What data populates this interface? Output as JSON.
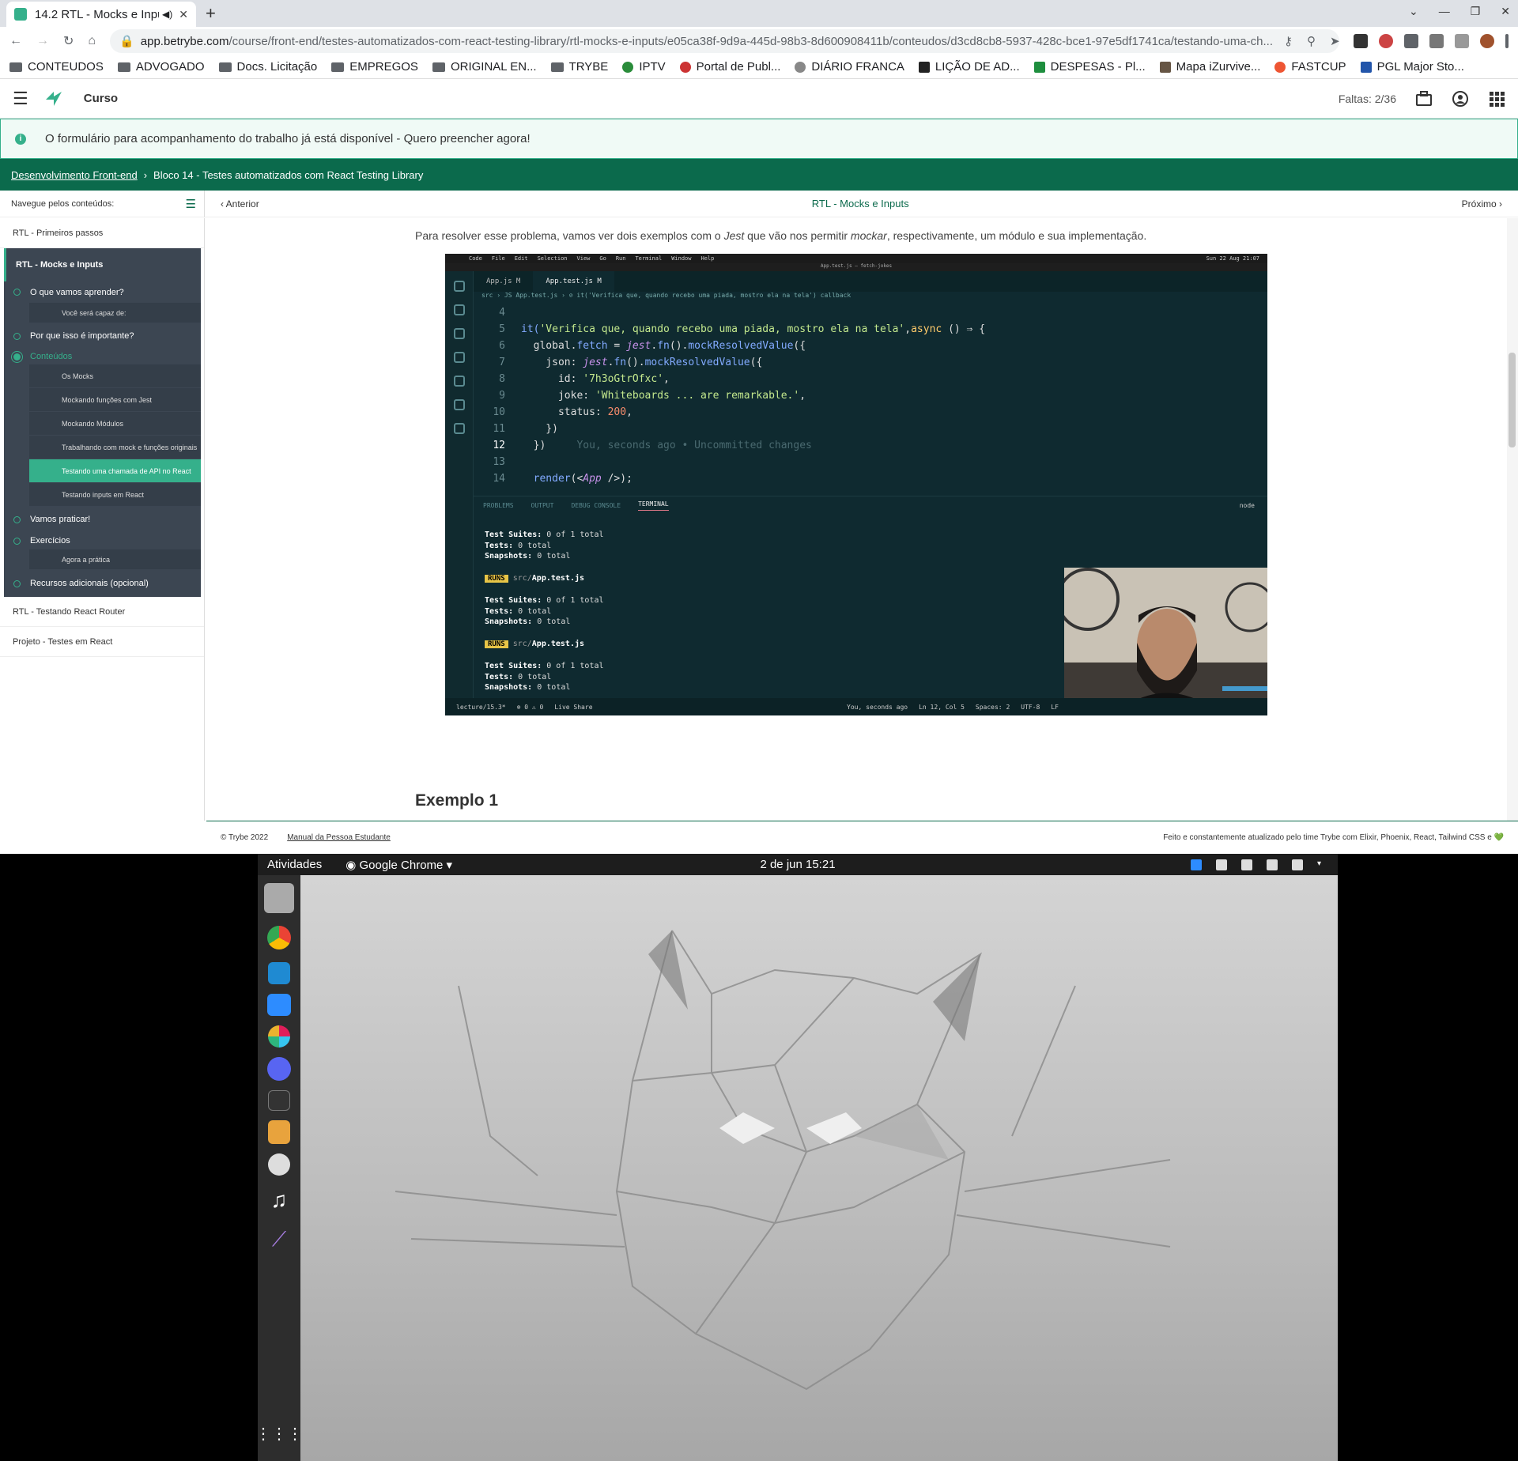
{
  "browser": {
    "tab_title": "14.2 RTL - Mocks e Inpu",
    "url_host": "app.betrybe.com",
    "url_path": "/course/front-end/testes-automatizados-com-react-testing-library/rtl-mocks-e-inputs/e05ca38f-9d9a-445d-98b3-8d600908411b/conteudos/d3cd8cb8-5937-428c-bce1-97e5df1741ca/testando-uma-ch...",
    "bookmarks": [
      "CONTEUDOS",
      "ADVOGADO",
      "Docs. Licitação",
      "EMPREGOS",
      "ORIGINAL EN...",
      "TRYBE",
      "IPTV",
      "Portal de Publ...",
      "DIÁRIO FRANCA",
      "LIÇÃO DE AD...",
      "DESPESAS - Pl...",
      "Mapa iZurvive...",
      "FASTCUP",
      "PGL Major Sto..."
    ]
  },
  "app": {
    "section": "Curso",
    "faltas": "Faltas: 2/36",
    "notice": "O formulário para acompanhamento do trabalho já está disponível - Quero preencher agora!",
    "breadcrumb": [
      "Desenvolvimento Front-end",
      "Bloco 14 - Testes automatizados com React Testing Library"
    ],
    "nav_label": "Navegue pelos conteúdos:",
    "prev": "Anterior",
    "next": "Próximo",
    "page_title": "RTL - Mocks e Inputs"
  },
  "sidebar": {
    "top_item": "RTL - Primeiros passos",
    "active_module": "RTL - Mocks e Inputs",
    "sections": [
      {
        "label": "O que vamos aprender?",
        "subs": [
          "Você será capaz de:"
        ]
      },
      {
        "label": "Por que isso é importante?",
        "subs": []
      },
      {
        "label": "Conteúdos",
        "subs": [
          "Os Mocks",
          "Mockando funções com Jest",
          "Mockando Módulos",
          "Trabalhando com mock e funções originais",
          "Testando uma chamada de API no React",
          "Testando inputs em React"
        ]
      },
      {
        "label": "Vamos praticar!",
        "subs": []
      },
      {
        "label": "Exercícios",
        "subs": [
          "Agora a prática"
        ]
      },
      {
        "label": "Recursos adicionais (opcional)",
        "subs": []
      }
    ],
    "bottom_items": [
      "RTL - Testando React Router",
      "Projeto - Testes em React"
    ]
  },
  "content": {
    "para_pre": "Para resolver esse problema, vamos ver dois exemplos com o ",
    "para_jest": "Jest",
    "para_mid": " que vão nos permitir ",
    "para_mockar": "mockar",
    "para_post": ", respectivamente, um módulo e sua implementação.",
    "heading": "Exemplo 1"
  },
  "video": {
    "mac_menu": [
      "Code",
      "File",
      "Edit",
      "Selection",
      "View",
      "Go",
      "Run",
      "Terminal",
      "Window",
      "Help"
    ],
    "mac_clock": "Sun 22 Aug 21:07",
    "window_title": "App.test.js — fetch-jokes",
    "tabs": [
      "App.js  M",
      "App.test.js  M"
    ],
    "breadcrumb": "src › JS App.test.js › ⊘ it('Verifica que, quando recebo uma piada, mostro ela na tela') callback",
    "code_lines": [
      {
        "n": "4",
        "parts": []
      },
      {
        "n": "5",
        "parts": [
          [
            "fn",
            "it("
          ],
          [
            "str",
            "'Verifica que, quando recebo uma piada, mostro ela na tela'"
          ],
          [
            "",
            ","
          ],
          [
            "kw",
            "async "
          ],
          [
            "",
            "() ⇒ {"
          ]
        ]
      },
      {
        "n": "6",
        "parts": [
          [
            "",
            "  global."
          ],
          [
            "fn",
            "fetch"
          ],
          [
            "",
            " = "
          ],
          [
            "ital",
            "jest"
          ],
          [
            "",
            "."
          ],
          [
            "fn",
            "fn"
          ],
          [
            "",
            "()."
          ],
          [
            "fn",
            "mockResolvedValue"
          ],
          [
            "",
            "({"
          ]
        ]
      },
      {
        "n": "7",
        "parts": [
          [
            "",
            "    json: "
          ],
          [
            "ital",
            "jest"
          ],
          [
            "",
            "."
          ],
          [
            "fn",
            "fn"
          ],
          [
            "",
            "()."
          ],
          [
            "fn",
            "mockResolvedValue"
          ],
          [
            "",
            "({"
          ]
        ]
      },
      {
        "n": "8",
        "parts": [
          [
            "",
            "      id: "
          ],
          [
            "str",
            "'7h3oGtrOfxc'"
          ],
          [
            "",
            ","
          ]
        ]
      },
      {
        "n": "9",
        "parts": [
          [
            "",
            "      joke: "
          ],
          [
            "str",
            "'Whiteboards ... are remarkable.'"
          ],
          [
            "",
            ","
          ]
        ]
      },
      {
        "n": "10",
        "parts": [
          [
            "",
            "      status: "
          ],
          [
            "num",
            "200"
          ],
          [
            "",
            ","
          ]
        ]
      },
      {
        "n": "11",
        "parts": [
          [
            "",
            "    })"
          ]
        ]
      },
      {
        "n": "12",
        "parts": [
          [
            "",
            "  })"
          ],
          [
            "blame",
            "     You, seconds ago • Uncommitted changes"
          ]
        ]
      },
      {
        "n": "13",
        "parts": []
      },
      {
        "n": "14",
        "parts": [
          [
            "",
            "  "
          ],
          [
            "fn",
            "render"
          ],
          [
            "",
            "(<"
          ],
          [
            "ital",
            "App"
          ],
          [
            "",
            " />);"
          ]
        ]
      }
    ],
    "panel_tabs": [
      "PROBLEMS",
      "OUTPUT",
      "DEBUG CONSOLE",
      "TERMINAL"
    ],
    "terminal_shell": "node",
    "terminal": {
      "suites_label": "Test Suites:",
      "suites_val": "0 of 1 total",
      "tests_label": "Tests:",
      "tests_val": "0 total",
      "snap_label": "Snapshots:",
      "snap_val": "0 total",
      "runs": "RUNS",
      "file_dir": "src/",
      "file_name": "App.test.js"
    },
    "status": {
      "branch": "lecture/15.3*",
      "errors": "⊗ 0 ⚠ 0",
      "live": "Live Share",
      "blame": "You, seconds ago",
      "pos": "Ln 12, Col 5",
      "spaces": "Spaces: 2",
      "enc": "UTF-8",
      "eol": "LF"
    }
  },
  "footer": {
    "copy": "© Trybe 2022",
    "manual": "Manual da Pessoa Estudante",
    "right": "Feito e constantemente atualizado pelo time Trybe com Elixir, Phoenix, React, Tailwind CSS e 💚"
  },
  "desktop": {
    "activities": "Atividades",
    "app": "Google Chrome",
    "clock": "2 de jun  15:21"
  }
}
